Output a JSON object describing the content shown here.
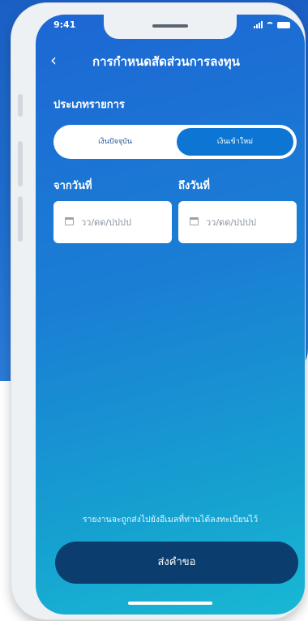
{
  "status_bar": {
    "time": "9:41"
  },
  "header": {
    "back_icon": "chevron-left-icon",
    "title": "การกำหนดสัดส่วนการลงทุน"
  },
  "form": {
    "type_label": "ประเภทรายการ",
    "toggle_options": [
      "เงินปัจจุบัน",
      "เงินเข้าใหม่"
    ],
    "selected_option": "เงินเข้าใหม่",
    "from_label": "จากวันที่",
    "to_label": "ถึงวันที่",
    "from_placeholder": "วว/ดด/ปปปป",
    "to_placeholder": "วว/ดด/ปปปป"
  },
  "footer": {
    "note": "รายงานจะถูกส่งไปยังอีเมลที่ท่านได้ลงทะเบียนไว้",
    "submit_label": "ส่งคำขอ"
  },
  "colors": {
    "background_blue": "#1b5fc4",
    "screen_gradient_start": "#1d67d4",
    "screen_gradient_end": "#19b8d4",
    "selected_tab": "#0d76d4",
    "submit_button": "#0b3d6e"
  }
}
